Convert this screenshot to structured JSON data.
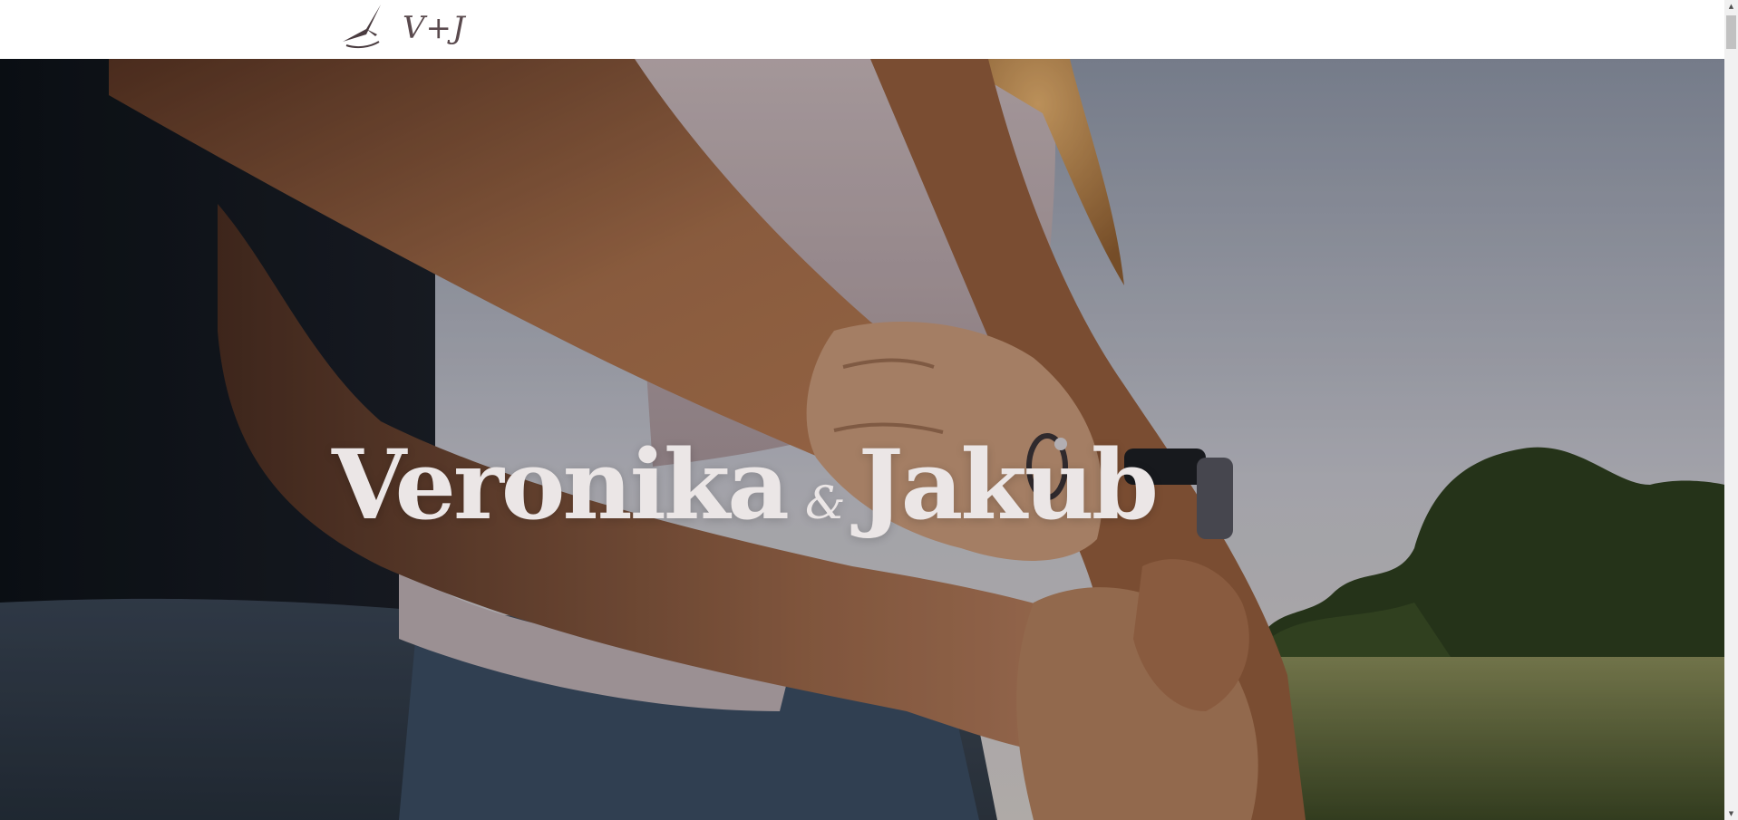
{
  "header": {
    "logo_text": "V+J",
    "logo_icon": "glider-plane-icon"
  },
  "hero": {
    "name_first": "Veronika",
    "ampersand": "&",
    "name_second": "Jakub",
    "image_subject": "embracing-couple-photo"
  },
  "scrollbar": {
    "up_glyph": "▲",
    "down_glyph": "▼"
  },
  "colors": {
    "header_bg": "#ffffff",
    "logo": "#5a4a4e",
    "title": "#ebe6e6",
    "scrollbar_track": "#f1f1f1",
    "scrollbar_thumb": "#c1c1c1"
  }
}
